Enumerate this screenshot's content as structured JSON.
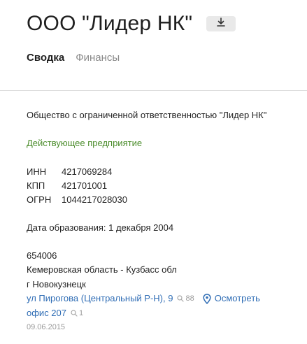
{
  "header": {
    "title": "ООО \"Лидер НК\"",
    "download_icon": "download-icon"
  },
  "tabs": [
    {
      "label": "Сводка",
      "active": true
    },
    {
      "label": "Финансы",
      "active": false
    }
  ],
  "company": {
    "full_name": "Общество с ограниченной ответственностью \"Лидер НК\"",
    "status": "Действующее предприятие",
    "codes": [
      {
        "label": "ИНН",
        "value": "4217069284"
      },
      {
        "label": "КПП",
        "value": "421701001"
      },
      {
        "label": "ОГРН",
        "value": "1044217028030"
      }
    ],
    "founded": "Дата образования: 1 декабря 2004"
  },
  "address": {
    "postal_code": "654006",
    "region": "Кемеровская область - Кузбасс обл",
    "city": "г Новокузнецк",
    "street": "ул Пирогова (Центральный Р-Н), 9",
    "street_count": "88",
    "view_label": "Осмотреть",
    "office": "офис 207",
    "office_count": "1",
    "date": "09.06.2015"
  },
  "colors": {
    "status_green": "#4a8c2a",
    "link_blue": "#2f6db5",
    "muted_gray": "#9a9a9a"
  }
}
